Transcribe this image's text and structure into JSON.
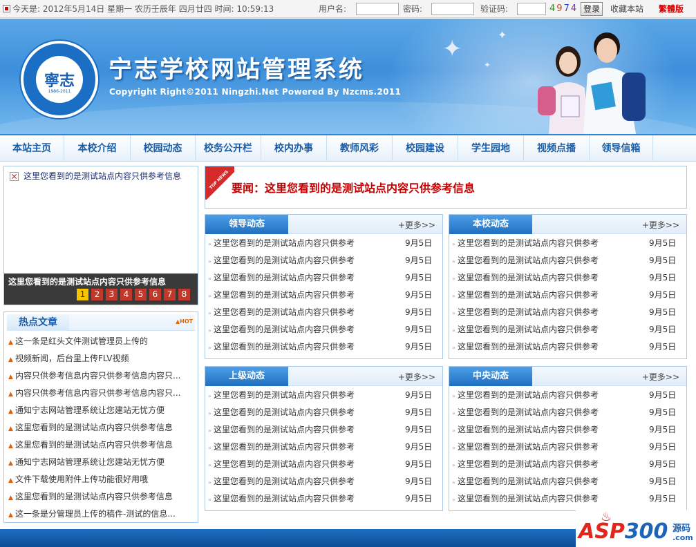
{
  "topbar": {
    "date_text": "今天是: 2012年5月14日  星期一  农历壬辰年  四月廿四  时间: 10:59:13",
    "username_label": "用户名:",
    "password_label": "密码:",
    "captcha_label": "验证码:",
    "captcha_digits": [
      "4",
      "9",
      "7",
      "4"
    ],
    "captcha_colors": [
      "#3a8a2a",
      "#c84a1a",
      "#1a4ac8",
      "#8a2ab0"
    ],
    "login_label": "登录",
    "favorite_label": "收藏本站",
    "traditional_label": "繁體版"
  },
  "banner": {
    "title": "宁志学校网站管理系统",
    "copyright": "Copyright Right©2011 Ningzhi.Net Powered By Nzcms.2011",
    "logo_mark": "寧志",
    "logo_years": "1986-2011"
  },
  "nav": {
    "items": [
      "本站主页",
      "本校介绍",
      "校园动态",
      "校务公开栏",
      "校内办事",
      "教师风彩",
      "校园建设",
      "学生园地",
      "视频点播",
      "领导信箱"
    ]
  },
  "slideshow": {
    "image_alt": "这里您看到的是测试站点内容只供参考信息",
    "caption": "这里您看到的是测试站点内容只供参考信息",
    "pages": [
      "1",
      "2",
      "3",
      "4",
      "5",
      "6",
      "7",
      "8"
    ],
    "active_page": "1"
  },
  "hot_articles": {
    "title": "热点文章",
    "badge": "HOT",
    "items": [
      "这一条是红头文件测试管理员上传的",
      "视频新闻，后台里上传FLV视频",
      "内容只供参考信息内容只供参考信息内容只...",
      "内容只供参考信息内容只供参考信息内容只...",
      "通知宁志网站管理系统让您建站无忧方便",
      "这里您看到的是测试站点内容只供参考信息",
      "这里您看到的是测试站点内容只供参考信息",
      "通知宁志网站管理系统让您建站无忧方便",
      "文件下载使用附件上传功能很好用哦",
      "这里您看到的是测试站点内容只供参考信息",
      "这一条是分管理员上传的稿件-测试的信息..."
    ]
  },
  "headline": {
    "ribbon": "TOP NEWS",
    "text": "要闻：这里您看到的是测试站点内容只供参考信息"
  },
  "boxes": [
    {
      "title": "领导动态",
      "more": "+更多>>",
      "items": [
        {
          "text": "这里您看到的是测试站点内容只供参考",
          "date": "9月5日"
        },
        {
          "text": "这里您看到的是测试站点内容只供参考",
          "date": "9月5日"
        },
        {
          "text": "这里您看到的是测试站点内容只供参考",
          "date": "9月5日"
        },
        {
          "text": "这里您看到的是测试站点内容只供参考",
          "date": "9月5日"
        },
        {
          "text": "这里您看到的是测试站点内容只供参考",
          "date": "9月5日"
        },
        {
          "text": "这里您看到的是测试站点内容只供参考",
          "date": "9月5日"
        },
        {
          "text": "这里您看到的是测试站点内容只供参考",
          "date": "9月5日"
        }
      ]
    },
    {
      "title": "本校动态",
      "more": "+更多>>",
      "items": [
        {
          "text": "这里您看到的是测试站点内容只供参考",
          "date": "9月5日"
        },
        {
          "text": "这里您看到的是测试站点内容只供参考",
          "date": "9月5日"
        },
        {
          "text": "这里您看到的是测试站点内容只供参考",
          "date": "9月5日"
        },
        {
          "text": "这里您看到的是测试站点内容只供参考",
          "date": "9月5日"
        },
        {
          "text": "这里您看到的是测试站点内容只供参考",
          "date": "9月5日"
        },
        {
          "text": "这里您看到的是测试站点内容只供参考",
          "date": "9月5日"
        },
        {
          "text": "这里您看到的是测试站点内容只供参考",
          "date": "9月5日"
        }
      ]
    },
    {
      "title": "上级动态",
      "more": "+更多>>",
      "items": [
        {
          "text": "这里您看到的是测试站点内容只供参考",
          "date": "9月5日"
        },
        {
          "text": "这里您看到的是测试站点内容只供参考",
          "date": "9月5日"
        },
        {
          "text": "这里您看到的是测试站点内容只供参考",
          "date": "9月5日"
        },
        {
          "text": "这里您看到的是测试站点内容只供参考",
          "date": "9月5日"
        },
        {
          "text": "这里您看到的是测试站点内容只供参考",
          "date": "9月5日"
        },
        {
          "text": "这里您看到的是测试站点内容只供参考",
          "date": "9月5日"
        },
        {
          "text": "这里您看到的是测试站点内容只供参考",
          "date": "9月5日"
        }
      ]
    },
    {
      "title": "中央动态",
      "more": "+更多>>",
      "items": [
        {
          "text": "这里您看到的是测试站点内容只供参考",
          "date": "9月5日"
        },
        {
          "text": "这里您看到的是测试站点内容只供参考",
          "date": "9月5日"
        },
        {
          "text": "这里您看到的是测试站点内容只供参考",
          "date": "9月5日"
        },
        {
          "text": "这里您看到的是测试站点内容只供参考",
          "date": "9月5日"
        },
        {
          "text": "这里您看到的是测试站点内容只供参考",
          "date": "9月5日"
        },
        {
          "text": "这里您看到的是测试站点内容只供参考",
          "date": "9月5日"
        },
        {
          "text": "这里您看到的是测试站点内容只供参考",
          "date": "9月5日"
        }
      ]
    }
  ],
  "watermark": {
    "brand_a": "ASP",
    "brand_b": "300",
    "side_top": "源码",
    "side_bottom": ".com"
  },
  "colors": {
    "nav_text": "#1b5da6",
    "headline_red": "#c40000",
    "box_title_bg": "#2f84d3",
    "pager_active": "#f6c400",
    "pager_bg": "#c0392b"
  }
}
